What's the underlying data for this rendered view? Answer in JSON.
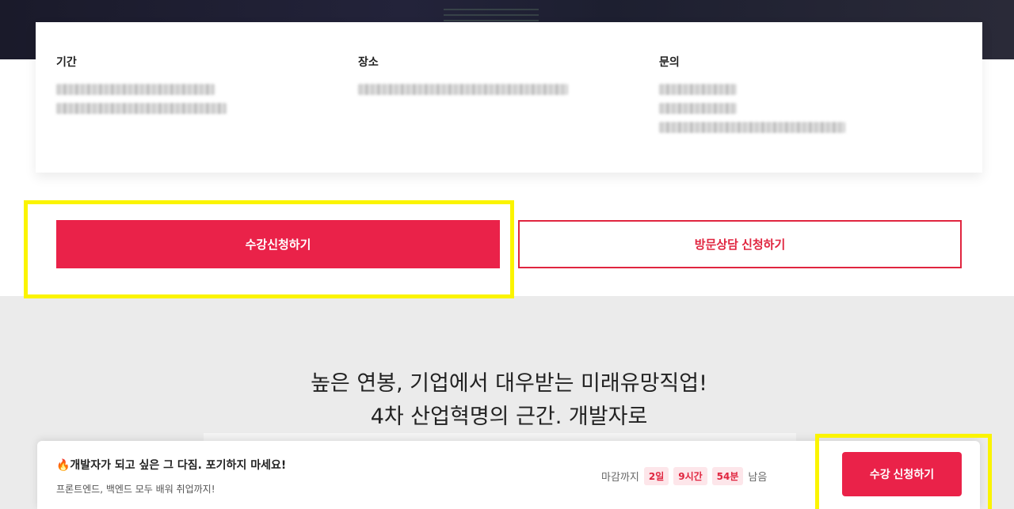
{
  "info": {
    "period_label": "기간",
    "place_label": "장소",
    "contact_label": "문의"
  },
  "actions": {
    "apply_label": "수강신청하기",
    "visit_label": "방문상담 신청하기"
  },
  "headline": {
    "line1": "높은 연봉, 기업에서 대우받는 미래유망직업!",
    "line2": "4차 산업혁명의 근간. 개발자로"
  },
  "bottom_bar": {
    "title": "🔥개발자가 되고 싶은 그 다짐. 포기하지 마세요!",
    "subtitle": "프론트엔드, 백엔드 모두 배워 취업까지!",
    "deadline_prefix": "마감까지",
    "days": "2일",
    "hours": "9시간",
    "minutes": "54분",
    "deadline_suffix": "남음",
    "apply_label": "수강 신청하기"
  },
  "colors": {
    "accent": "#ea2249",
    "highlight": "#fbf400"
  }
}
